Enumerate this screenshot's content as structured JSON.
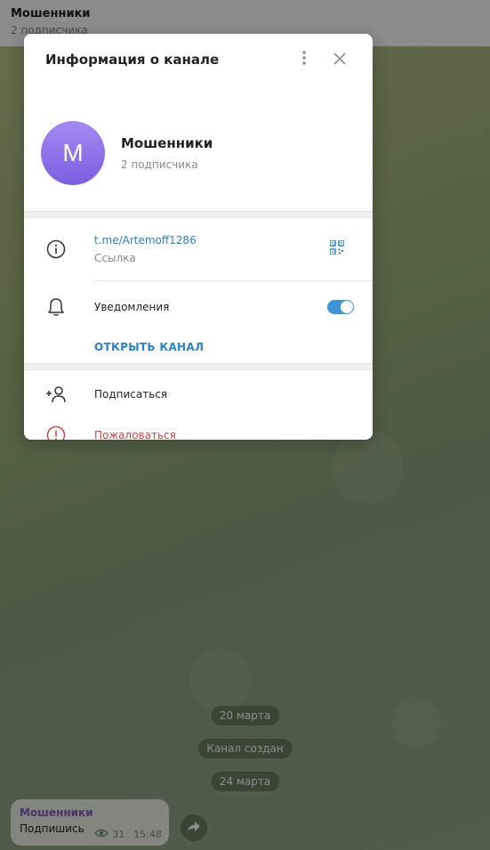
{
  "chat": {
    "title": "Мошенники",
    "subtitle": "2 подписчика",
    "dates": [
      "20 марта",
      "Канал создан",
      "24 марта"
    ],
    "message": {
      "author": "Мошенники",
      "text": "Подпишись",
      "views": "31",
      "time": "15:48"
    }
  },
  "modal": {
    "title": "Информация о канале",
    "avatar_letter": "M",
    "name": "Мошенники",
    "subscribers": "2 подписчика",
    "link": "t.me/Artemoff1286",
    "link_label": "Ссылка",
    "notifications_label": "Уведомления",
    "notifications_on": true,
    "open_channel": "ОТКРЫТЬ КАНАЛ",
    "subscribe": "Подписаться",
    "report": "Пожаловаться"
  },
  "colors": {
    "accent": "#2a83c6",
    "avatar": "#8b6ee8",
    "danger": "#d0454c",
    "toggle": "#3d95d6"
  },
  "icons": [
    "more-vertical-icon",
    "close-icon",
    "info-icon",
    "qr-code-icon",
    "bell-icon",
    "add-user-icon",
    "report-icon",
    "eye-icon",
    "forward-icon"
  ]
}
